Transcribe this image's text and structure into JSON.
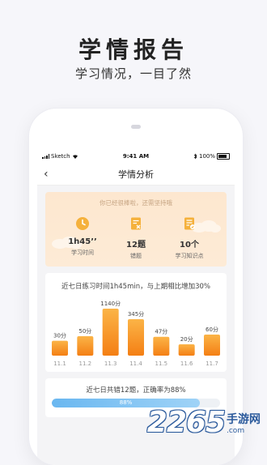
{
  "promo": {
    "title": "学情报告",
    "subtitle": "学习情况，一目了然"
  },
  "status": {
    "carrier": "Sketch",
    "time": "9:41 AM",
    "battery": "100%"
  },
  "nav": {
    "back": "‹",
    "title": "学情分析"
  },
  "summary": {
    "message": "你已经很棒啦，还需坚持哦",
    "stats": [
      {
        "icon": "clock-icon",
        "value": "1h45’’",
        "label": "学习时间"
      },
      {
        "icon": "wrong-questions-icon",
        "value": "12题",
        "label": "错题"
      },
      {
        "icon": "knowledge-points-icon",
        "value": "10个",
        "label": "学习知识点"
      }
    ]
  },
  "weekly": {
    "headline": "近七日练习时间1h45min，与上期相比增加30%"
  },
  "chart_data": {
    "type": "bar",
    "categories": [
      "11.1",
      "11.2",
      "11.3",
      "11.4",
      "11.5",
      "11.6",
      "11.7"
    ],
    "values": [
      30,
      50,
      1140,
      345,
      47,
      20,
      60
    ],
    "value_labels": [
      "30分",
      "50分",
      "1140分",
      "345分",
      "47分",
      "20分",
      "60分"
    ],
    "bar_color": "#f59a23"
  },
  "accuracy": {
    "headline": "近七日共错12题，正确率为88%",
    "percent_label": "88%",
    "percent": 88
  },
  "watermark": {
    "number": "2265",
    "suffix": ".com",
    "site": "手游网"
  }
}
